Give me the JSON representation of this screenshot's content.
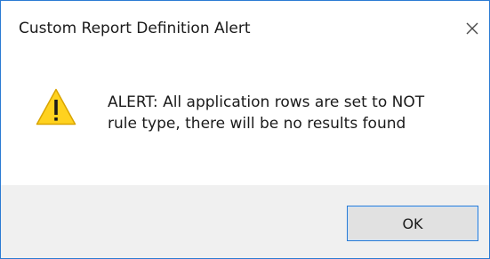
{
  "dialog": {
    "title": "Custom Report Definition Alert",
    "close_icon": "close-icon",
    "message_line1": "ALERT: All application rows are set to NOT",
    "message_line2": "rule type, there will be no results found",
    "warning_icon": "warning-icon",
    "ok_label": "OK"
  },
  "colors": {
    "border": "#2b7bd3",
    "footer_bg": "#f0f0f0",
    "button_bg": "#e1e1e1",
    "warning_yellow": "#ffd21f"
  }
}
